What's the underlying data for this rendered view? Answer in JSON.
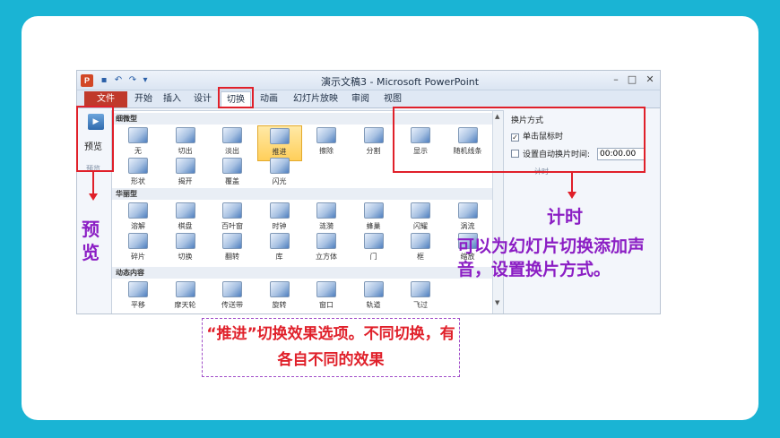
{
  "titlebar": {
    "app_icon": "P",
    "title": "演示文稿3 - Microsoft PowerPoint",
    "save_icon": "save-icon",
    "undo_icon": "undo-icon",
    "redo_icon": "redo-icon"
  },
  "tabs": [
    {
      "label": "文件"
    },
    {
      "label": "开始"
    },
    {
      "label": "插入"
    },
    {
      "label": "设计"
    },
    {
      "label": "切换"
    },
    {
      "label": "动画"
    },
    {
      "label": "幻灯片放映"
    },
    {
      "label": "审阅"
    },
    {
      "label": "视图"
    }
  ],
  "ribbon": {
    "preview_label": "预览",
    "preview_group_label": "预览",
    "gallery": {
      "sections": [
        {
          "title": "细微型",
          "items": [
            "无",
            "切出",
            "淡出",
            "推进",
            "擦除",
            "分割",
            "显示",
            "随机线条",
            "形状",
            "揭开",
            "覆盖",
            "闪光"
          ]
        },
        {
          "title": "华丽型",
          "items": [
            "溶解",
            "棋盘",
            "百叶窗",
            "时钟",
            "涟漪",
            "蜂巢",
            "闪耀",
            "涡流",
            "碎片",
            "切换",
            "翻转",
            "库",
            "立方体",
            "门",
            "框",
            "缩放"
          ]
        },
        {
          "title": "动态内容",
          "items": [
            "平移",
            "摩天轮",
            "传送带",
            "旋转",
            "窗口",
            "轨道",
            "飞过"
          ]
        }
      ],
      "selected": "推进"
    },
    "timing": {
      "title": "换片方式",
      "on_click_label": "单击鼠标时",
      "on_click_checked": true,
      "auto_label": "设置自动换片时间:",
      "auto_checked": false,
      "time_value": "00:00.00",
      "group_label": "计时"
    }
  },
  "callouts": {
    "preview": "预览",
    "timing": "计时",
    "sound": "可以为幻灯片切换添加声音，设置换片方式。",
    "push": "“推进”切换效果选项。不同切换，有各自不同的效果"
  },
  "colors": {
    "background": "#1ab4d4",
    "accent_red": "#e0202a",
    "callout_purple": "#8b1ec4"
  }
}
